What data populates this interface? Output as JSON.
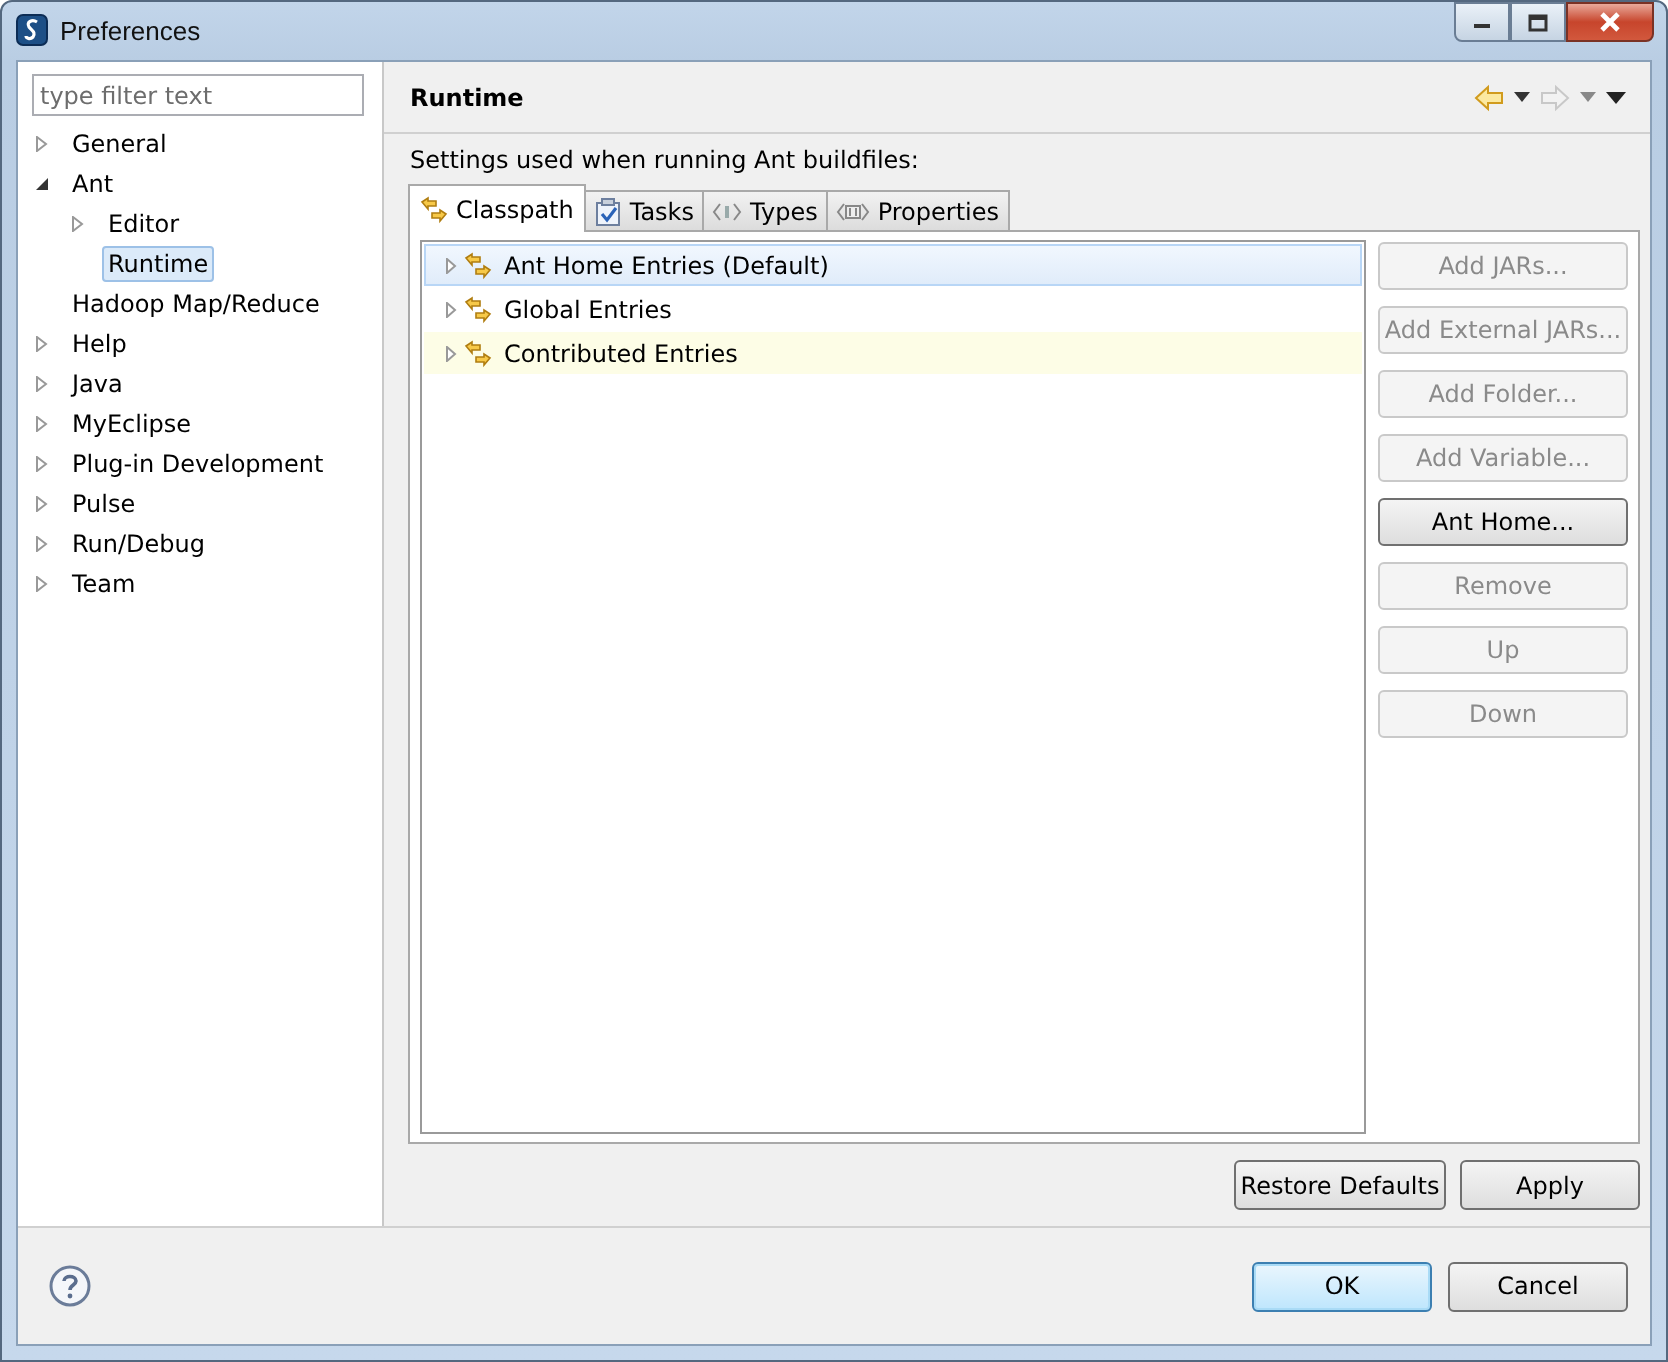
{
  "window": {
    "title": "Preferences"
  },
  "filter": {
    "placeholder": "type filter text"
  },
  "tree": [
    {
      "label": "General",
      "kind": "expandable",
      "expanded": false,
      "selected": false
    },
    {
      "label": "Ant",
      "kind": "expandable",
      "expanded": true,
      "selected": false,
      "children": [
        {
          "label": "Editor",
          "kind": "expandable",
          "expanded": false,
          "selected": false
        },
        {
          "label": "Runtime",
          "kind": "leaf",
          "selected": true
        }
      ]
    },
    {
      "label": "Hadoop Map/Reduce",
      "kind": "leaf",
      "selected": false
    },
    {
      "label": "Help",
      "kind": "expandable",
      "expanded": false,
      "selected": false
    },
    {
      "label": "Java",
      "kind": "expandable",
      "expanded": false,
      "selected": false
    },
    {
      "label": "MyEclipse",
      "kind": "expandable",
      "expanded": false,
      "selected": false
    },
    {
      "label": "Plug-in Development",
      "kind": "expandable",
      "expanded": false,
      "selected": false
    },
    {
      "label": "Pulse",
      "kind": "expandable",
      "expanded": false,
      "selected": false
    },
    {
      "label": "Run/Debug",
      "kind": "expandable",
      "expanded": false,
      "selected": false
    },
    {
      "label": "Team",
      "kind": "expandable",
      "expanded": false,
      "selected": false
    }
  ],
  "page": {
    "title": "Runtime",
    "back_enabled": true,
    "forward_enabled": false,
    "description": "Settings used when running Ant buildfiles:",
    "tabs": [
      {
        "label": "Classpath",
        "kind": "classpath",
        "selected": true
      },
      {
        "label": "Tasks",
        "kind": "tasks",
        "selected": false
      },
      {
        "label": "Types",
        "kind": "types",
        "selected": false
      },
      {
        "label": "Properties",
        "kind": "properties",
        "selected": false
      }
    ],
    "entries": [
      {
        "label": "Ant Home Entries (Default)",
        "selected": true,
        "hovered": false
      },
      {
        "label": "Global Entries",
        "selected": false,
        "hovered": false
      },
      {
        "label": "Contributed Entries",
        "selected": false,
        "hovered": true
      }
    ],
    "side_buttons": [
      {
        "label": "Add JARs...",
        "disabled": true
      },
      {
        "label": "Add External JARs...",
        "disabled": true
      },
      {
        "label": "Add Folder...",
        "disabled": true
      },
      {
        "label": "Add Variable...",
        "disabled": true
      },
      {
        "label": "Ant Home...",
        "disabled": false
      },
      {
        "label": "Remove",
        "disabled": true
      },
      {
        "label": "Up",
        "disabled": true
      },
      {
        "label": "Down",
        "disabled": true
      }
    ],
    "page_buttons": [
      "Restore Defaults",
      "Apply"
    ]
  },
  "dialog_buttons": [
    {
      "label": "OK",
      "default": true
    },
    {
      "label": "Cancel",
      "default": false
    }
  ]
}
